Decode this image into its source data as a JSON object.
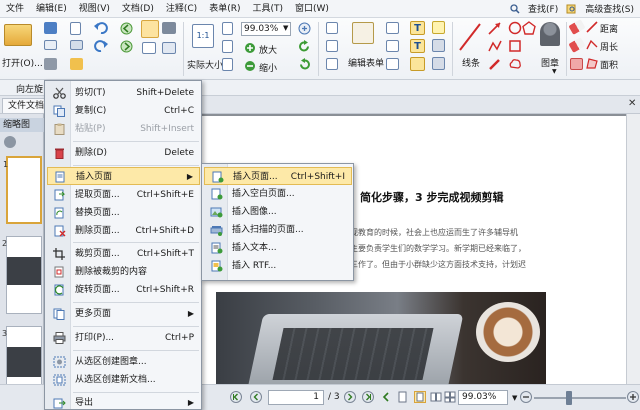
{
  "menubar": {
    "items": [
      "文件",
      "编辑(E)",
      "视图(V)",
      "文档(D)",
      "注释(C)",
      "表单(R)",
      "工具(T)",
      "窗口(W)"
    ],
    "search_label": "查找(F)",
    "advanced_search_label": "高级查找(S)"
  },
  "ribbon": {
    "open_label": "打开(O)...",
    "zoom_value": "99.03%",
    "zoom_in_label": "放大",
    "zoom_out_label": "缩小",
    "actual_size_label": "实际大小",
    "edit_form_label": "编辑表单",
    "lines_label": "线条",
    "stamp_label": "图章",
    "distance_label": "距离",
    "perimeter_label": "周长",
    "area_label": "面积",
    "rotate_left_label": "向左旋"
  },
  "tabs": {
    "doc_tab": "文件文档",
    "thumbnails_label": "缩略图"
  },
  "thumbs": [
    "1",
    "2",
    "3"
  ],
  "document": {
    "heading": "简化步骤，3 步完成视频剪辑",
    "lines": [
      "视教育的时候，社会上也应运而生了许多辅导机",
      "主要负责学生们的数学学习。新学期已经来临了，",
      "三作了。但由于小群缺少这方面技术支持，计划迟"
    ]
  },
  "bottombar": {
    "page_value": "1",
    "page_total": "/ 3",
    "zoom_value": "99.03%"
  },
  "context_menu": [
    {
      "label": "剪切(T)",
      "shortcut": "Shift+Delete",
      "icon": "scissors-icon",
      "disabled": false
    },
    {
      "label": "复制(C)",
      "shortcut": "Ctrl+C",
      "icon": "copy-icon",
      "disabled": false
    },
    {
      "label": "粘贴(P)",
      "shortcut": "Shift+Insert",
      "icon": "paste-icon",
      "disabled": true
    },
    {
      "label": "删除(D)",
      "shortcut": "Delete",
      "icon": "trash-icon",
      "disabled": false
    },
    {
      "label": "插入页面",
      "shortcut": "",
      "icon": "insert-page-icon",
      "disabled": false,
      "submenu": true
    },
    {
      "label": "提取页面...",
      "shortcut": "Ctrl+Shift+E",
      "icon": "extract-page-icon",
      "disabled": false
    },
    {
      "label": "替换页面...",
      "shortcut": "",
      "icon": "replace-page-icon",
      "disabled": false
    },
    {
      "label": "删除页面...",
      "shortcut": "Ctrl+Shift+D",
      "icon": "delete-page-icon",
      "disabled": false
    },
    {
      "label": "裁剪页面...",
      "shortcut": "Ctrl+Shift+T",
      "icon": "crop-page-icon",
      "disabled": false
    },
    {
      "label": "删除被裁剪的内容",
      "shortcut": "",
      "icon": "remove-cropped-icon",
      "disabled": false
    },
    {
      "label": "旋转页面...",
      "shortcut": "Ctrl+Shift+R",
      "icon": "rotate-page-icon",
      "disabled": false
    },
    {
      "label": "更多页面",
      "shortcut": "",
      "icon": "more-pages-icon",
      "disabled": false,
      "submenu": true
    },
    {
      "label": "打印(P)...",
      "shortcut": "Ctrl+P",
      "icon": "printer-icon",
      "disabled": false
    },
    {
      "label": "从选区创建图章...",
      "shortcut": "",
      "icon": "stamp-from-selection-icon",
      "disabled": false
    },
    {
      "label": "从选区创建新文档...",
      "shortcut": "",
      "icon": "doc-from-selection-icon",
      "disabled": false
    },
    {
      "label": "导出",
      "shortcut": "",
      "icon": "export-icon",
      "disabled": false,
      "submenu": true
    }
  ],
  "submenu": [
    {
      "label": "插入页面...",
      "shortcut": "Ctrl+Shift+I",
      "icon": "insert-page-file-icon"
    },
    {
      "label": "插入空白页面...",
      "shortcut": "",
      "icon": "blank-page-icon"
    },
    {
      "label": "插入图像...",
      "shortcut": "",
      "icon": "insert-image-icon"
    },
    {
      "label": "插入扫描的页面...",
      "shortcut": "",
      "icon": "scanner-icon"
    },
    {
      "label": "插入文本...",
      "shortcut": "",
      "icon": "insert-text-icon"
    },
    {
      "label": "插入 RTF...",
      "shortcut": "",
      "icon": "insert-rtf-icon"
    }
  ],
  "colors": {
    "highlight": "#fde9a8",
    "highlight_border": "#e3bb54",
    "menu_bg": "#f4f6f9"
  }
}
